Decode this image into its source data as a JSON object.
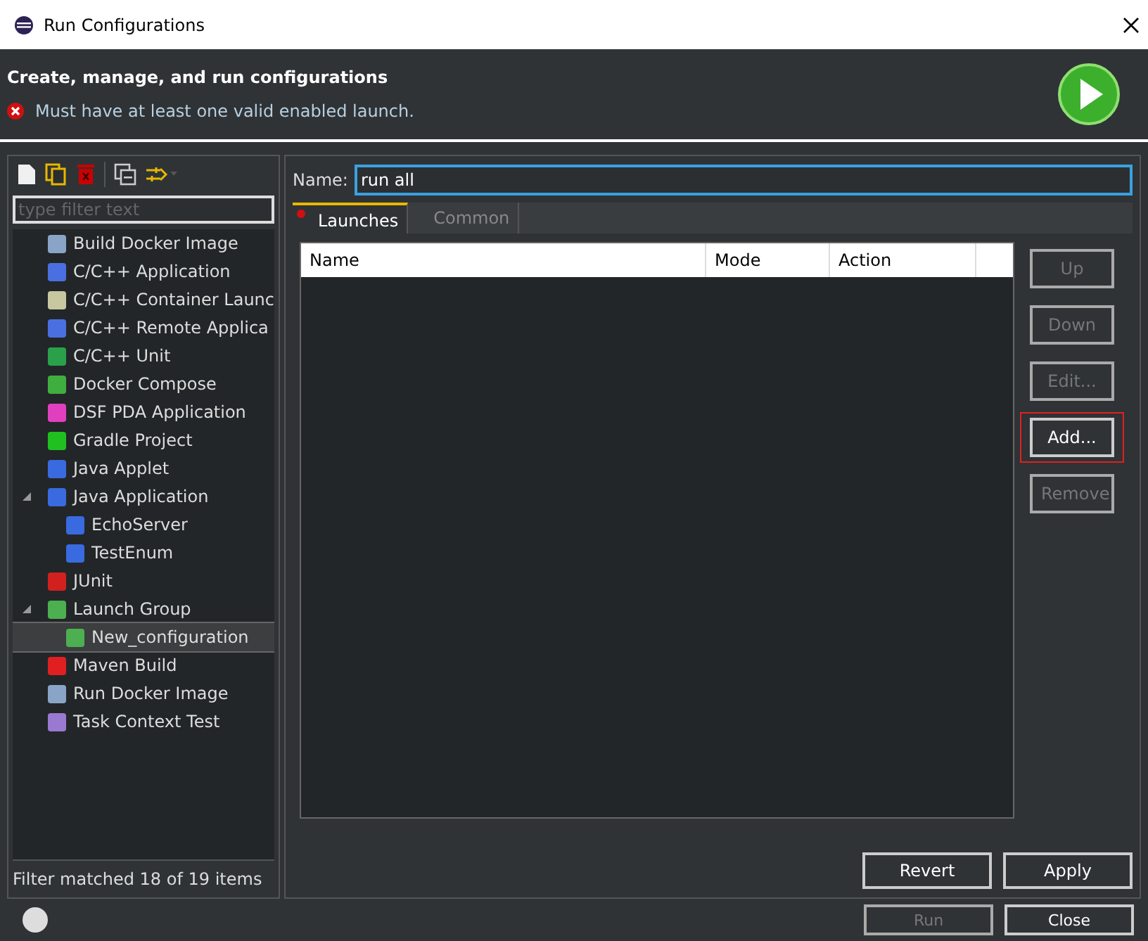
{
  "window": {
    "title": "Run Configurations"
  },
  "header": {
    "title": "Create, manage, and run configurations",
    "message": "Must have at least one valid enabled launch."
  },
  "filter": {
    "placeholder": "type filter text"
  },
  "tree": [
    {
      "label": "Build Docker Image",
      "kind": "docker",
      "selected": false
    },
    {
      "label": "C/C++ Application",
      "kind": "c-app",
      "selected": false
    },
    {
      "label": "C/C++ Container Launc",
      "kind": "c-container",
      "selected": false
    },
    {
      "label": "C/C++ Remote Applica",
      "kind": "c-app",
      "selected": false
    },
    {
      "label": "C/C++ Unit",
      "kind": "c-unit",
      "selected": false
    },
    {
      "label": "Docker Compose",
      "kind": "compose",
      "selected": false
    },
    {
      "label": "DSF PDA Application",
      "kind": "dsf",
      "selected": false
    },
    {
      "label": "Gradle Project",
      "kind": "gradle",
      "selected": false
    },
    {
      "label": "Java Applet",
      "kind": "java",
      "selected": false
    },
    {
      "label": "Java Application",
      "kind": "java",
      "selected": false,
      "expanded": true,
      "children": [
        {
          "label": "EchoServer",
          "kind": "java",
          "selected": false
        },
        {
          "label": "TestEnum",
          "kind": "java",
          "selected": false
        }
      ]
    },
    {
      "label": "JUnit",
      "kind": "junit",
      "selected": false
    },
    {
      "label": "Launch Group",
      "kind": "launch",
      "selected": false,
      "expanded": true,
      "children": [
        {
          "label": "New_configuration",
          "kind": "launch",
          "selected": true
        }
      ]
    },
    {
      "label": "Maven Build",
      "kind": "maven",
      "selected": false
    },
    {
      "label": "Run Docker Image",
      "kind": "docker",
      "selected": false
    },
    {
      "label": "Task Context Test",
      "kind": "task",
      "selected": false
    }
  ],
  "filter_status": "Filter matched 18 of 19 items",
  "name_field": {
    "label": "Name:",
    "value": "run all"
  },
  "tabs": [
    {
      "label": "Launches",
      "selected": true,
      "error": true
    },
    {
      "label": "Common",
      "selected": false,
      "error": false
    }
  ],
  "table": {
    "columns": [
      "Name",
      "Mode",
      "Action"
    ]
  },
  "side_buttons": [
    {
      "label": "Up",
      "disabled": true,
      "highlighted": false
    },
    {
      "label": "Down",
      "disabled": true,
      "highlighted": false
    },
    {
      "label": "Edit...",
      "disabled": true,
      "highlighted": false
    },
    {
      "label": "Add...",
      "disabled": false,
      "highlighted": true
    },
    {
      "label": "Remove",
      "disabled": true,
      "highlighted": false
    }
  ],
  "form_buttons": [
    {
      "label": "Revert",
      "disabled": false
    },
    {
      "label": "Apply",
      "disabled": false
    }
  ],
  "dialog_buttons": [
    {
      "label": "Run",
      "disabled": true
    },
    {
      "label": "Close",
      "disabled": false
    }
  ]
}
